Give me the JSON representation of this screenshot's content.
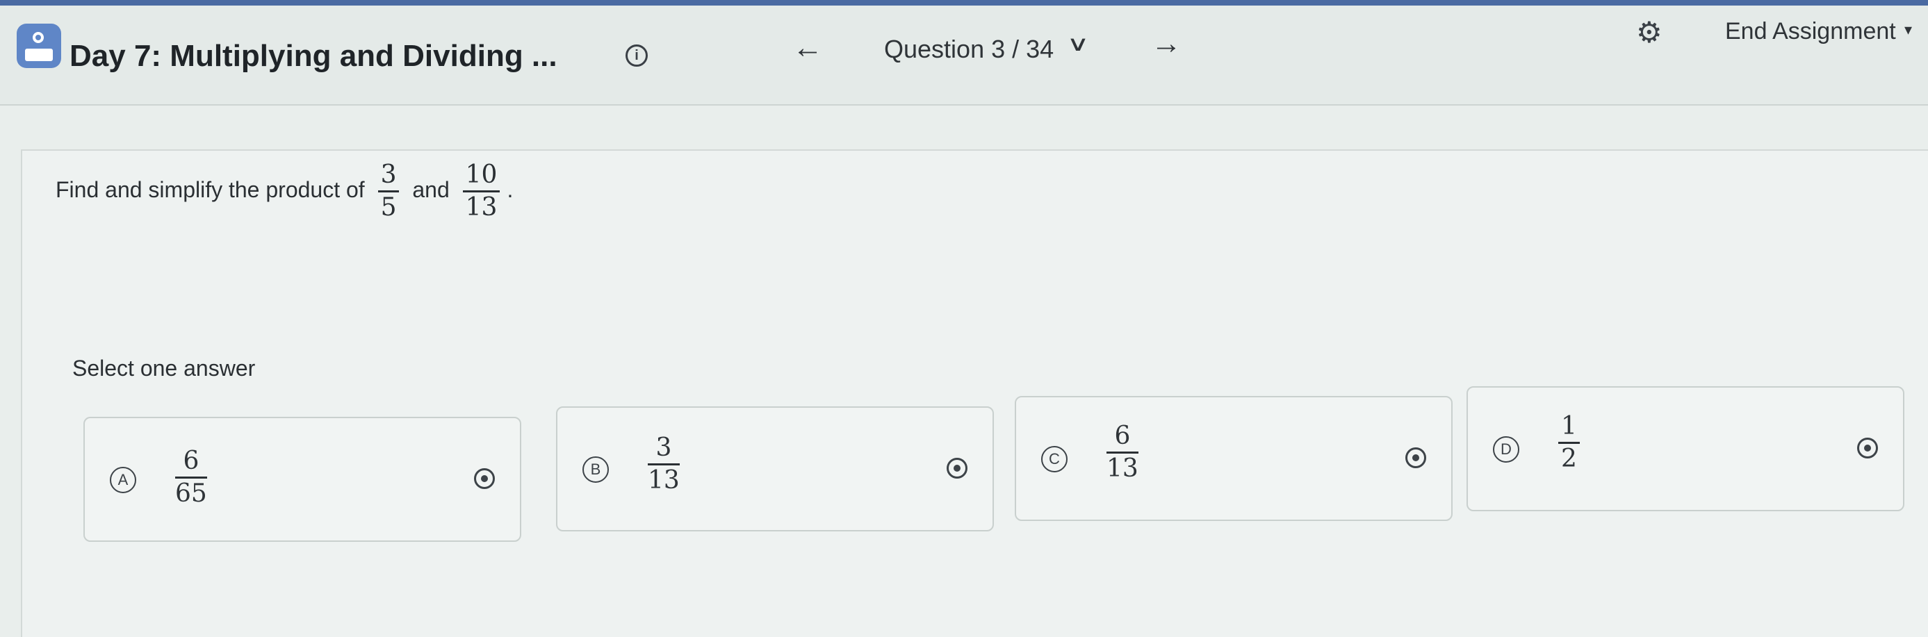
{
  "header": {
    "title": "Day 7: Multiplying and Dividing ...",
    "info_icon": "info-icon",
    "question_label": "Question 3 / 34",
    "prev_icon": "←",
    "next_icon": "→",
    "dropdown_icon": "chevron-down-icon",
    "settings_icon": "gear-icon",
    "end_label": "End Assignment"
  },
  "question": {
    "prefix": "Find and simplify the product of",
    "frac1": {
      "num": "3",
      "den": "5"
    },
    "joiner": "and",
    "frac2": {
      "num": "10",
      "den": "13"
    },
    "suffix": "."
  },
  "answers": {
    "prompt": "Select one answer",
    "options": [
      {
        "letter": "A",
        "num": "6",
        "den": "65"
      },
      {
        "letter": "B",
        "num": "3",
        "den": "13"
      },
      {
        "letter": "C",
        "num": "6",
        "den": "13"
      },
      {
        "letter": "D",
        "num": "1",
        "den": "2"
      }
    ]
  },
  "colors": {
    "brand": "#5f86c7",
    "background": "#e9eeec",
    "text": "#2f3438"
  }
}
